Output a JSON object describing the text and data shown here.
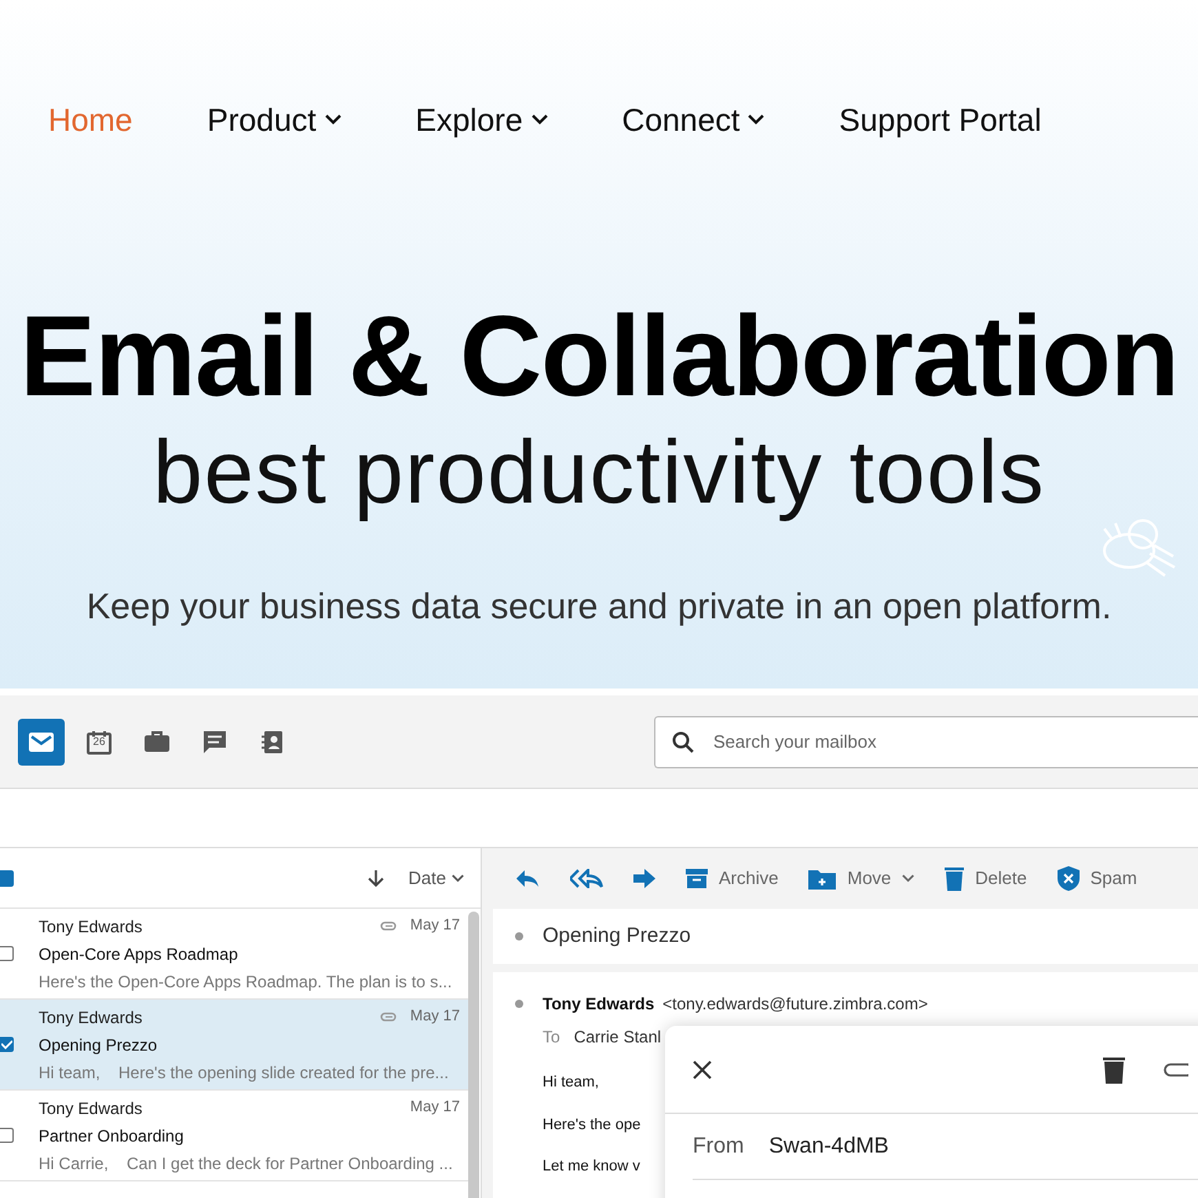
{
  "nav": [
    {
      "label": "Home",
      "selected": true,
      "dropdown": false
    },
    {
      "label": "Product",
      "selected": false,
      "dropdown": true
    },
    {
      "label": "Explore",
      "selected": false,
      "dropdown": true
    },
    {
      "label": "Connect",
      "selected": false,
      "dropdown": true
    },
    {
      "label": "Support Portal",
      "selected": false,
      "dropdown": false
    }
  ],
  "hero": {
    "title": "Email & Collaboration",
    "subtitle": "best productivity tools",
    "tagline": "Keep your business data secure and private in an open platform."
  },
  "app": {
    "apps": [
      {
        "kind": "mail",
        "selected": true
      },
      {
        "kind": "calendar",
        "selected": false,
        "label": "26"
      },
      {
        "kind": "briefcase",
        "selected": false
      },
      {
        "kind": "chat",
        "selected": false
      },
      {
        "kind": "contacts",
        "selected": false
      }
    ],
    "search": {
      "placeholder": "Search your mailbox"
    },
    "list_header": {
      "checked": true,
      "sort": "Date"
    },
    "messages": [
      {
        "sender": "Tony Edwards",
        "subject": "Open-Core Apps Roadmap",
        "preview": "Here's the Open-Core Apps Roadmap. The plan is to s...",
        "date": "May 17",
        "attachment": true,
        "checked": false,
        "selected": false
      },
      {
        "sender": "Tony Edwards",
        "subject": "Opening Prezzo",
        "preview": "Hi team,    Here's the opening slide created for the pre...",
        "date": "May 17",
        "attachment": true,
        "checked": true,
        "selected": true
      },
      {
        "sender": "Tony Edwards",
        "subject": "Partner Onboarding",
        "preview": "Hi Carrie,    Can I get the deck for Partner Onboarding ...",
        "date": "May 17",
        "attachment": false,
        "checked": false,
        "selected": false
      }
    ],
    "toolbar": [
      {
        "kind": "reply"
      },
      {
        "kind": "reply-all"
      },
      {
        "kind": "forward"
      },
      {
        "kind": "archive",
        "label": "Archive"
      },
      {
        "kind": "move",
        "label": "Move"
      },
      {
        "kind": "delete",
        "label": "Delete"
      },
      {
        "kind": "spam",
        "label": "Spam"
      }
    ],
    "reader": {
      "subject": "Opening Prezzo",
      "from_name": "Tony Edwards",
      "from_address": "<tony.edwards@future.zimbra.com>",
      "to_label": "To",
      "to": "Carrie Stanl",
      "body": [
        "Hi team,",
        "Here's the ope",
        "Let me know v"
      ]
    },
    "compose": {
      "from_label": "From",
      "from": "Swan-4dMB"
    }
  }
}
